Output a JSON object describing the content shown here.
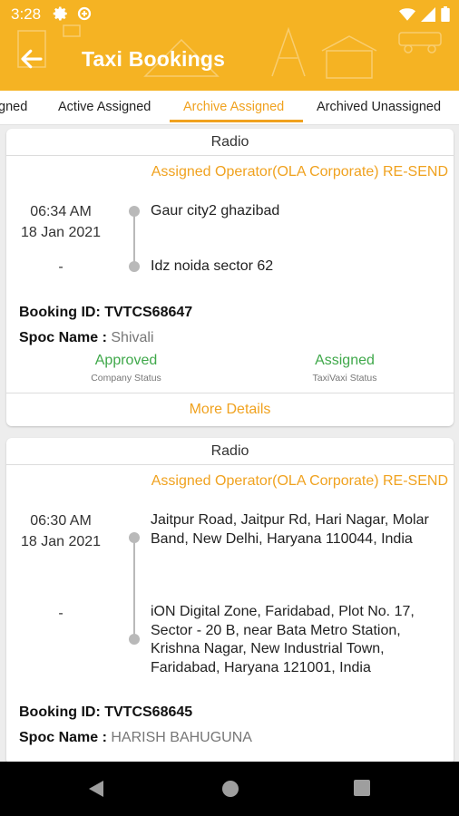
{
  "status_bar": {
    "time": "3:28"
  },
  "app_bar": {
    "title": "Taxi Bookings"
  },
  "tabs": [
    {
      "label": "gned"
    },
    {
      "label": "Active Assigned"
    },
    {
      "label": "Archive Assigned",
      "active": true
    },
    {
      "label": "Archived Unassigned"
    }
  ],
  "bookings": [
    {
      "type": "Radio",
      "operator_text": "Assigned Operator(OLA Corporate) RE-SEND",
      "time": "06:34 AM",
      "date": "18 Jan 2021",
      "end_time": "-",
      "pickup": "Gaur city2 ghazibad",
      "drop": "Idz noida sector 62",
      "booking_id_label": "Booking ID:",
      "booking_id": "TVTCS68647",
      "spoc_label": "Spoc Name :",
      "spoc_name": "Shivali",
      "company_status": "Approved",
      "company_status_label": "Company Status",
      "taxivaxi_status": "Assigned",
      "taxivaxi_status_label": "TaxiVaxi Status",
      "more_label": "More Details"
    },
    {
      "type": "Radio",
      "operator_text": "Assigned Operator(OLA Corporate) RE-SEND",
      "time": "06:30 AM",
      "date": "18 Jan 2021",
      "end_time": "-",
      "pickup": "Jaitpur Road, Jaitpur Rd, Hari Nagar, Molar Band, New Delhi, Haryana 110044, India",
      "drop": "iON Digital Zone, Faridabad, Plot No. 17, Sector - 20 B, near Bata Metro Station, Krishna Nagar, New Industrial Town, Faridabad, Haryana 121001, India",
      "booking_id_label": "Booking ID:",
      "booking_id": "TVTCS68645",
      "spoc_label": "Spoc Name :",
      "spoc_name": "HARISH BAHUGUNA"
    }
  ],
  "colors": {
    "primary": "#f5b323",
    "accent": "#f0a21f",
    "status_green": "#3fa84a"
  },
  "icons": [
    "settings-icon",
    "data-saver-icon",
    "wifi-icon",
    "signal-icon",
    "battery-icon",
    "back-arrow-icon",
    "nav-back-icon",
    "nav-home-icon",
    "nav-recents-icon"
  ]
}
